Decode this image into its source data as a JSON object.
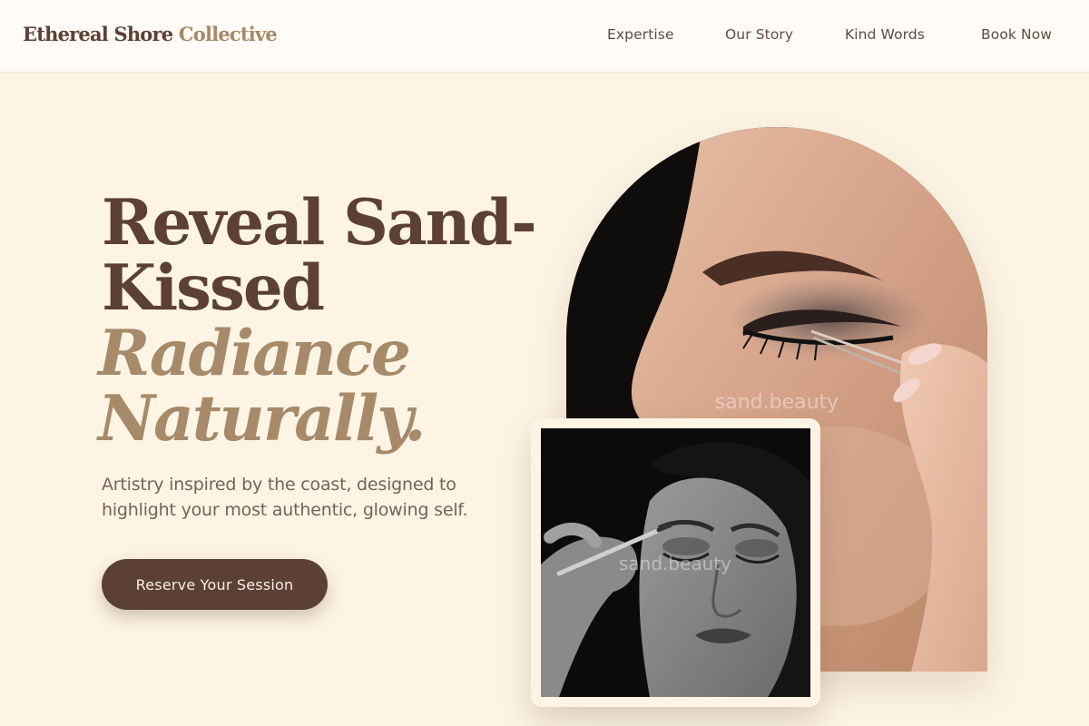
{
  "brand": {
    "name_primary": "Ethereal Shore",
    "name_accent": "Collective"
  },
  "nav": {
    "items": [
      {
        "label": "Expertise"
      },
      {
        "label": "Our Story"
      },
      {
        "label": "Kind Words"
      },
      {
        "label": "Book Now"
      }
    ]
  },
  "hero": {
    "title_line1": "Reveal Sand-",
    "title_line2": "Kissed",
    "title_italic_line1": "Radiance",
    "title_italic_line2": "Naturally.",
    "subtitle_line1": "Artistry inspired by the coast, designed to",
    "subtitle_line2": "highlight your most authentic, glowing self.",
    "cta_label": "Reserve Your Session"
  },
  "images": {
    "main_watermark": "sand.beauty",
    "inset_watermark": "sand.beauty"
  },
  "colors": {
    "background": "#fdf4e4",
    "header_background": "#fffbf6",
    "primary_brown": "#5c4035",
    "accent_tan": "#a68a69",
    "body_text": "#75635a"
  }
}
